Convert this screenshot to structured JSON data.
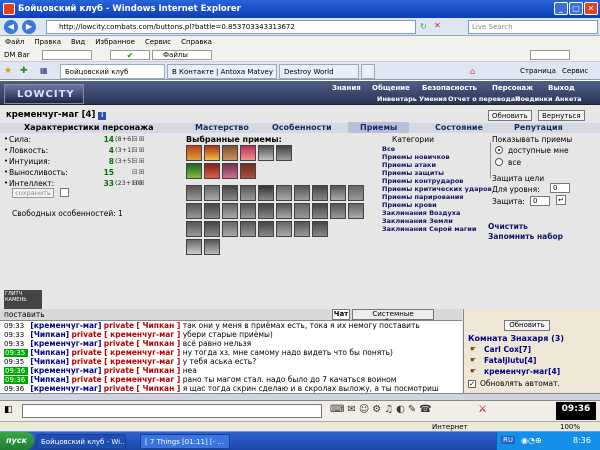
{
  "window": {
    "title": "Бойцовский клуб - Windows Internet Explorer"
  },
  "browser": {
    "url": "http://lowcity.combats.com/buttons.pl?battle=0.853703343313672",
    "search_placeholder": "Live Search",
    "menu": [
      "Файл",
      "Правка",
      "Вид",
      "Избранное",
      "Сервис",
      "Справка"
    ],
    "dm_label": "DM Bar",
    "files_label": "Файлы",
    "tabs": [
      "Бойцовский клуб",
      "В Контакте | Antoxa Matvey",
      "Destroy World"
    ],
    "right_tools": [
      "Страница",
      "Сервис"
    ]
  },
  "game": {
    "logo": "LOWCITY",
    "nav_top": [
      "Знания",
      "Общение",
      "Безопасность",
      "Персонаж",
      "Выход"
    ],
    "nav_sub": [
      "Инвентарь",
      "Умения",
      "Отчет о переводах",
      "Поединки",
      "Анкета"
    ],
    "character": {
      "name": "кременчуг-маг",
      "level": "[4]"
    },
    "buttons": {
      "refresh": "Обновить",
      "back": "Вернуться",
      "save": "сохранить",
      "clear": "Очистить",
      "remember": "Запомнить набор"
    },
    "tabs": [
      "Мастерство",
      "Особенности",
      "Приемы",
      "Состояние",
      "Репутация"
    ],
    "stats_title": "Характеристики персонажа",
    "stats": [
      {
        "label": "Сила:",
        "value": "14",
        "bonus": "(8+6)"
      },
      {
        "label": "Ловкость:",
        "value": "4",
        "bonus": "(3+1)"
      },
      {
        "label": "Интуиция:",
        "value": "8",
        "bonus": "(3+5)"
      },
      {
        "label": "Выносливость:",
        "value": "15",
        "bonus": ""
      },
      {
        "label": "Интеллект:",
        "value": "33",
        "bonus": "(23+10)"
      }
    ],
    "free_features": "Свободных особенностей: 1",
    "chosen_title": "Выбранные приемы:",
    "categories_title": "Категории",
    "categories": [
      "Все",
      "Приемы новичков",
      "Приемы атаки",
      "Приемы защиты",
      "Приемы контрударов",
      "Приемы критических ударов",
      "Приемы парирования",
      "Приемы крови",
      "Заклинания Воздуха",
      "Заклинания Земли",
      "Заклинания Серой магии"
    ],
    "show_title": "Показывать приемы",
    "show_options": [
      "доступные мне",
      "все"
    ],
    "protect_title": "Защита цели",
    "levels_label": "Для уровня:",
    "level_value": "0",
    "protect_label": "Защита:",
    "protect_value": "0",
    "tooltip": "ГЛИТЧ КАМЕНЬ"
  },
  "chat": {
    "input_label": "поставить",
    "tabs": [
      "Чат",
      "Системные сообщения"
    ],
    "messages": [
      {
        "time": "09:33",
        "hl": false,
        "from": "[кременчуг-маг]",
        "tag": "private",
        "to": "[ Чипкан ]",
        "text": "так они у меня в приёмах есть, тока я их немогу поставить"
      },
      {
        "time": "09:33",
        "hl": false,
        "from": "[Чипкан]",
        "tag": "private",
        "to": "[ кременчуг-маг ]",
        "text": "убери старые приёмы)"
      },
      {
        "time": "09:33",
        "hl": false,
        "from": "[кременчуг-маг]",
        "tag": "private",
        "to": "[ Чипкан ]",
        "text": "всё равно нельзя"
      },
      {
        "time": "09:35",
        "hl": true,
        "from": "[Чипкан]",
        "tag": "private",
        "to": "[ кременчуг-маг ]",
        "text": "ну тогда хз. мне самому надо видеть что бы понять)"
      },
      {
        "time": "09:35",
        "hl": false,
        "from": "[Чипкан]",
        "tag": "private",
        "to": "[ кременчуг-маг ]",
        "text": "у тебя аська есть?"
      },
      {
        "time": "09:36",
        "hl": true,
        "from": "[кременчуг-маг]",
        "tag": "private",
        "to": "[ Чипкан ]",
        "text": "неа"
      },
      {
        "time": "09:36",
        "hl": true,
        "from": "[Чипкан]",
        "tag": "private",
        "to": "[ кременчуг-маг ]",
        "text": "рано ты магом стал. надо было до 7 качаться воином"
      },
      {
        "time": "09:36",
        "hl": false,
        "from": "[кременчуг-маг]",
        "tag": "private",
        "to": "[ Чипкан ]",
        "text": "я щас тогда скрин сделаю и в скролах выложу, а ты посмотриш"
      }
    ]
  },
  "room": {
    "refresh": "Обновить",
    "title": "Комната Знахаря (3)",
    "users": [
      {
        "name": "Carl Cox",
        "level": "[7]"
      },
      {
        "name": "Fataljlutu",
        "level": "[4]"
      },
      {
        "name": "кременчуг-маг",
        "level": "[4]"
      }
    ],
    "auto_update": "Обновлять автомат."
  },
  "status": {
    "zone": "Интернет",
    "zoom": "100%",
    "lang": "RU"
  },
  "taskbar": {
    "start": "пуск",
    "tasks": [
      "Бойцовский клуб - Wi...",
      "[ 7 Things [01:11] [- ..."
    ],
    "clock": "8:36",
    "game_clock": "09:36"
  }
}
